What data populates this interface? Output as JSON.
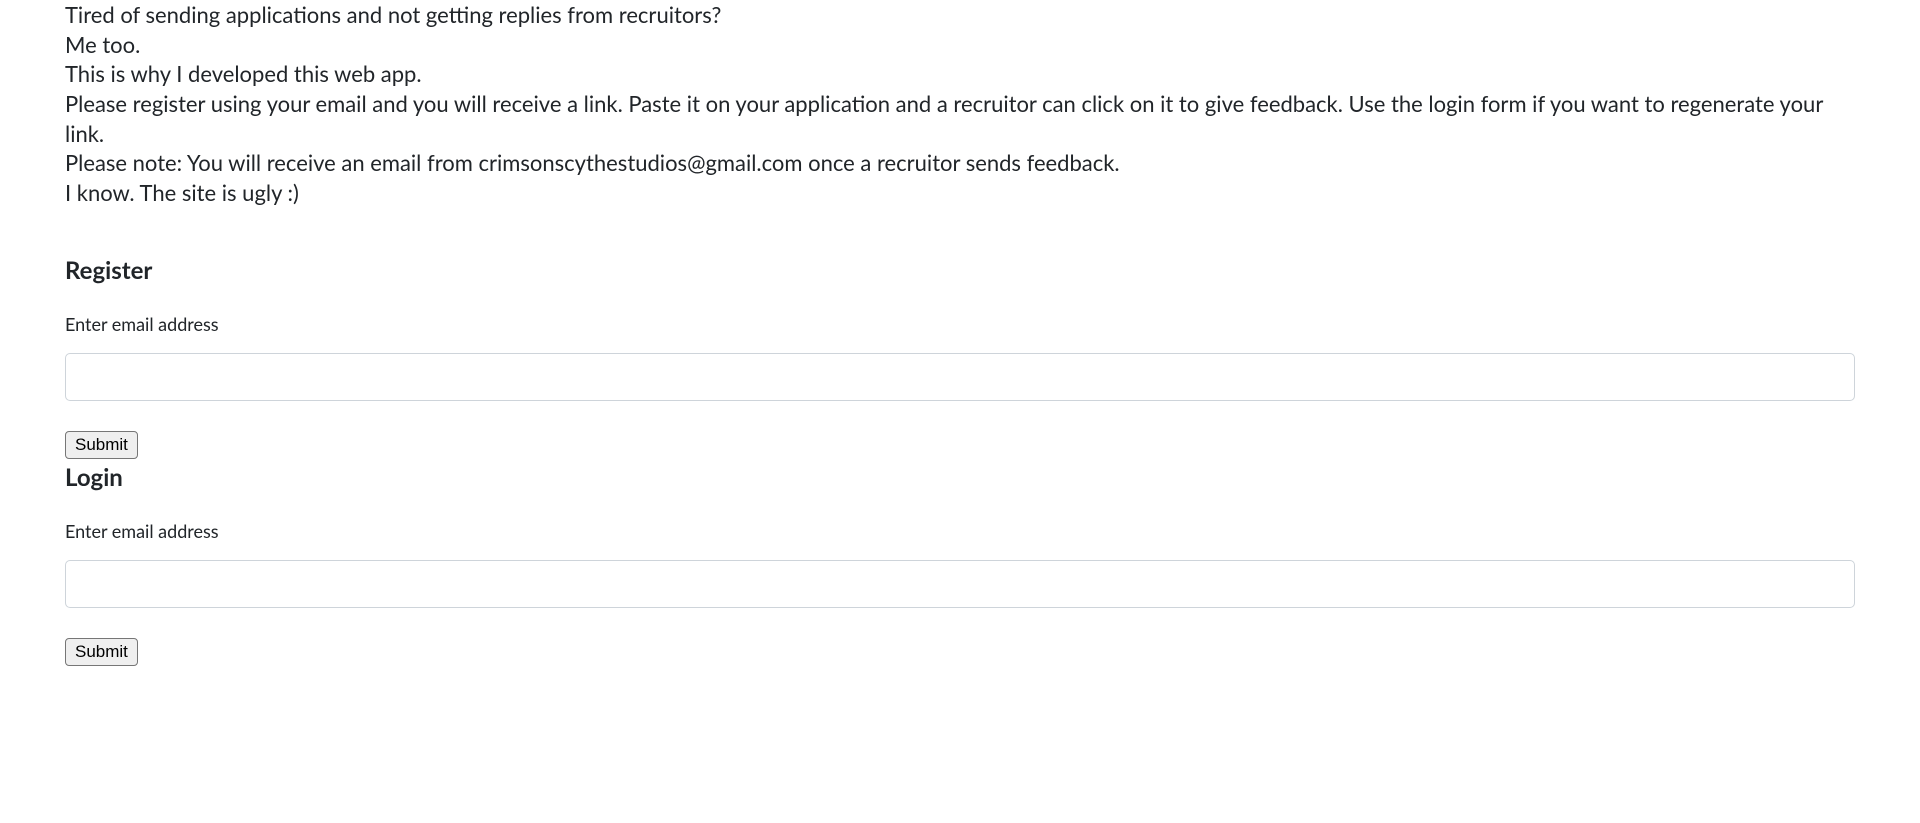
{
  "intro": {
    "line1": "Tired of sending applications and not getting replies from recruitors?",
    "line2": "Me too.",
    "line3": "This is why I developed this web app.",
    "line4": "Please register using your email and you will receive a link. Paste it on your application and a recruitor can click on it to give feedback. Use the login form if you want to regenerate your link.",
    "line5": "Please note: You will receive an email from crimsonscythestudios@gmail.com once a recruitor sends feedback.",
    "line6": "I know. The site is ugly :)"
  },
  "register": {
    "heading": "Register",
    "email_label": "Enter email address",
    "submit_label": "Submit"
  },
  "login": {
    "heading": "Login",
    "email_label": "Enter email address",
    "submit_label": "Submit"
  }
}
